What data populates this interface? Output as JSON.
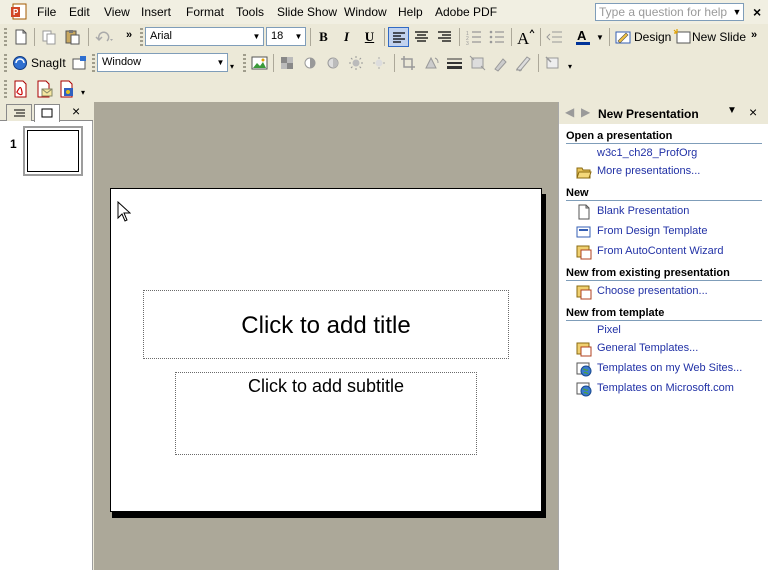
{
  "menubar": {
    "items": [
      "File",
      "Edit",
      "View",
      "Insert",
      "Format",
      "Tools",
      "Slide Show",
      "Window",
      "Help",
      "Adobe PDF"
    ],
    "help_placeholder": "Type a question for help",
    "close": "×"
  },
  "toolbar": {
    "font_name": "Arial",
    "font_size": "18",
    "bold": "B",
    "italic": "I",
    "underline": "U",
    "design_label": "Design",
    "new_slide_label": "New Slide",
    "snagit_label": "SnagIt",
    "window_combo": "Window",
    "chevron": "»"
  },
  "slides_pane": {
    "slide_number": "1",
    "close": "×"
  },
  "slide": {
    "title_placeholder": "Click to add title",
    "subtitle_placeholder": "Click to add subtitle"
  },
  "task_pane": {
    "title": "New Presentation",
    "close": "×",
    "sections": {
      "open": {
        "heading": "Open a presentation",
        "recent": "w3c1_ch28_ProfOrg",
        "more": "More presentations..."
      },
      "new": {
        "heading": "New",
        "blank": "Blank Presentation",
        "design": "From Design Template",
        "autocontent": "From AutoContent Wizard"
      },
      "existing": {
        "heading": "New from existing presentation",
        "choose": "Choose presentation..."
      },
      "template": {
        "heading": "New from template",
        "pixel": "Pixel",
        "general": "General Templates...",
        "websites": "Templates on my Web Sites...",
        "microsoft": "Templates on Microsoft.com"
      }
    }
  }
}
